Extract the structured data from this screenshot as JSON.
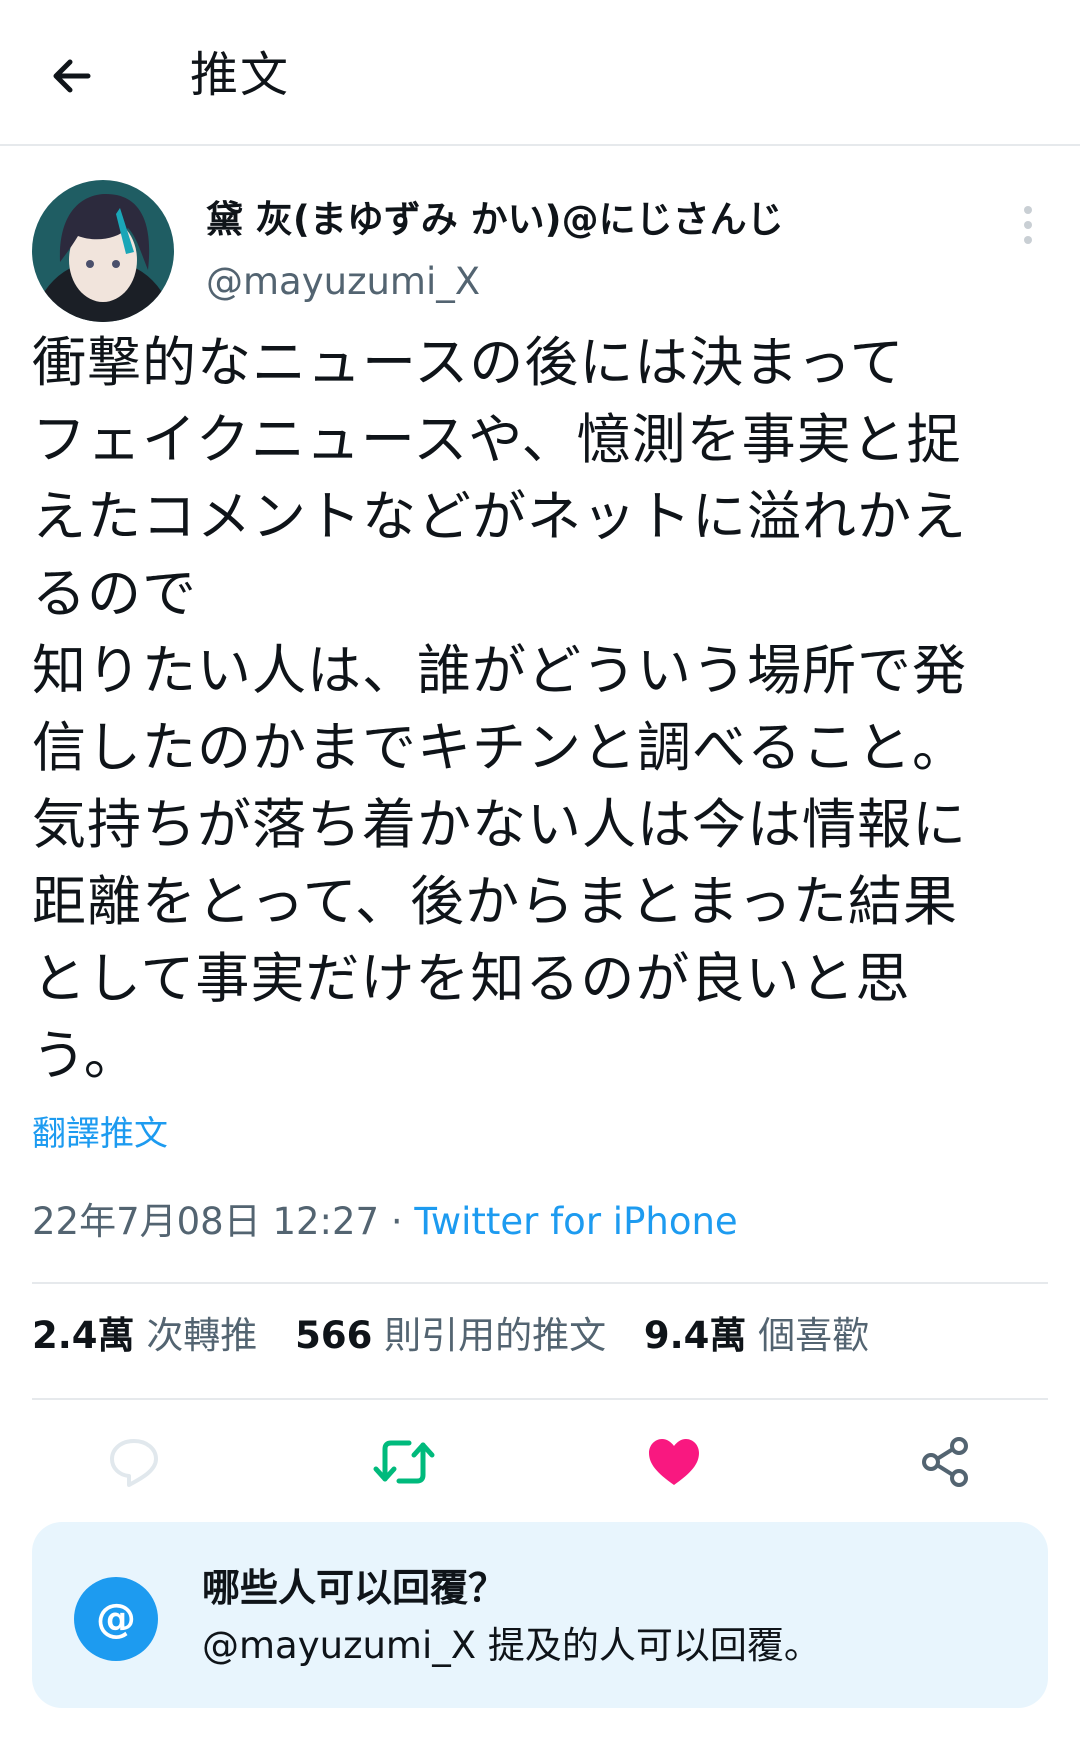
{
  "header": {
    "title": "推文",
    "back_icon": "arrow-left-icon"
  },
  "tweet": {
    "author": {
      "display_name": "黛 灰(まゆずみ かい)@にじさんじ",
      "handle": "@mayuzumi_X",
      "avatar_icon": "avatar-icon"
    },
    "text": "衝撃的なニュースの後には決まって\nフェイクニュースや、憶測を事実と捉\nえたコメントなどがネットに溢れかえ\nるので\n知りたい人は、誰がどういう場所で発\n信したのかまでキチンと調べること。\n気持ちが落ち着かない人は今は情報に\n距離をとって、後からまとまった結果\nとして事実だけを知るのが良いと思\nう。",
    "translate_label": "翻譯推文",
    "timestamp": "22年7月08日 12:27",
    "separator": " · ",
    "source": "Twitter for iPhone"
  },
  "stats": {
    "retweets": {
      "value": "2.4萬",
      "label": "次轉推"
    },
    "quotes": {
      "value": "566",
      "label": "則引用的推文"
    },
    "likes": {
      "value": "9.4萬",
      "label": "個喜歡"
    }
  },
  "actions": [
    {
      "name": "reply",
      "icon": "comment-icon"
    },
    {
      "name": "retweet",
      "icon": "retweet-icon",
      "active": true
    },
    {
      "name": "like",
      "icon": "heart-icon",
      "active": true
    },
    {
      "name": "share",
      "icon": "share-icon"
    }
  ],
  "reply_restriction": {
    "title": "哪些人可以回覆？",
    "subtitle": "@mayuzumi_X 提及的人可以回覆。",
    "icon_text": "@"
  },
  "colors": {
    "accent": "#1d9bf0",
    "retweet_active": "#00ba7c",
    "like_active": "#f91880",
    "secondary_text": "#536471",
    "card_bg": "#e8f5fd"
  }
}
